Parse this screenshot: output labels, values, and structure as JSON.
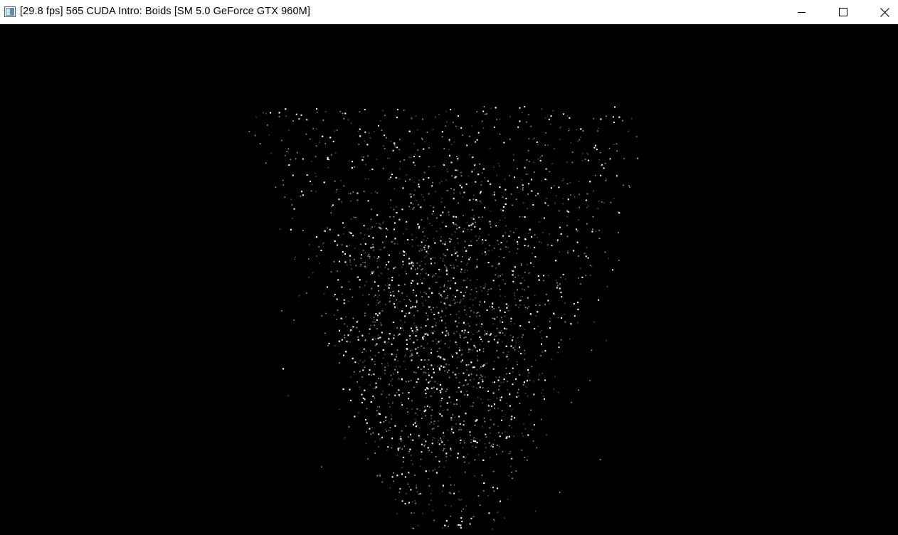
{
  "window": {
    "title": "[29.8 fps] 565 CUDA Intro: Boids [SM 5.0 GeForce GTX 960M]",
    "app_icon": "opengl-window-icon",
    "controls": {
      "minimize": "minimize-icon",
      "maximize": "maximize-icon",
      "close": "close-icon"
    }
  },
  "scene": {
    "background_color": "#000000",
    "particle_colors": {
      "bright": "#ffffff",
      "mid": "#9a9a9a",
      "dim": "#4a4a4a"
    }
  }
}
